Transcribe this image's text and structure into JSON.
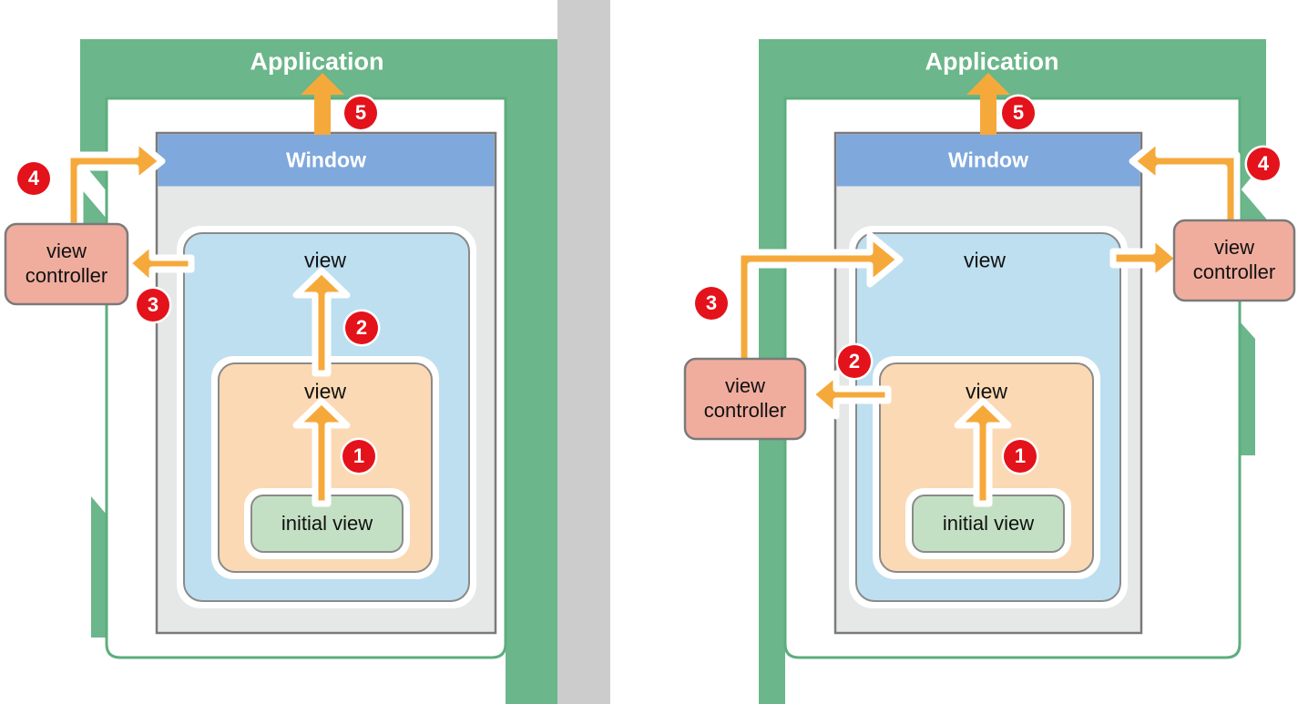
{
  "meta": {
    "title": "Application window and view hierarchy load order",
    "panels": 2
  },
  "colors": {
    "application_green": "#6BB68A",
    "window_titlebar_blue": "#7FA8DC",
    "window_body_gray": "#E6E7E7",
    "view_blue": "#BEDFF0",
    "view_orange": "#FAD9B4",
    "initial_view_green": "#C4E0C4",
    "view_controller_pink": "#F0AD9E",
    "arrow_orange": "#F6A93B",
    "badge_red": "#E3121B",
    "divider_gray": "#CCCCCC",
    "box_stroke_gray": "#7A7A7A",
    "white": "#FFFFFF"
  },
  "labels": {
    "application": "Application",
    "window": "Window",
    "view": "view",
    "initial_view": "initial view",
    "view_controller": "view controller",
    "view_controller_line1": "view",
    "view_controller_line2": "controller"
  },
  "left_panel": {
    "name": "storyboard-initial-load-left",
    "application_label": "Application",
    "window_label": "Window",
    "outer_view_label": "view",
    "inner_view_label": "view",
    "initial_view_label": "initial view",
    "view_controller_label": "view controller",
    "steps": [
      {
        "number": "1",
        "from": "initial view",
        "to": "inner view",
        "direction": "up"
      },
      {
        "number": "2",
        "from": "inner view",
        "to": "outer view",
        "direction": "up"
      },
      {
        "number": "3",
        "from": "outer view",
        "to": "view controller",
        "direction": "left"
      },
      {
        "number": "4",
        "from": "view controller",
        "to": "Window",
        "direction": "right-up"
      },
      {
        "number": "5",
        "from": "Window",
        "to": "Application",
        "direction": "up"
      }
    ],
    "badge_numbers": [
      "1",
      "2",
      "3",
      "4",
      "5"
    ]
  },
  "right_panel": {
    "name": "storyboard-initial-load-right",
    "application_label": "Application",
    "window_label": "Window",
    "outer_view_label": "view",
    "inner_view_label": "view",
    "initial_view_label": "initial view",
    "view_controller_lower_label": "view controller",
    "view_controller_upper_label": "view controller",
    "steps": [
      {
        "number": "1",
        "from": "initial view",
        "to": "inner view",
        "direction": "up"
      },
      {
        "number": "2",
        "from": "inner view",
        "to": "lower view controller",
        "direction": "left"
      },
      {
        "number": "3",
        "from": "lower view controller",
        "to": "outer view",
        "direction": "up-right"
      },
      {
        "number": "4",
        "from": "upper view controller",
        "to": "Window",
        "direction": "left"
      },
      {
        "number": "5",
        "from": "Window",
        "to": "Application",
        "direction": "up"
      }
    ],
    "badge_numbers": [
      "1",
      "2",
      "3",
      "4",
      "5"
    ]
  }
}
